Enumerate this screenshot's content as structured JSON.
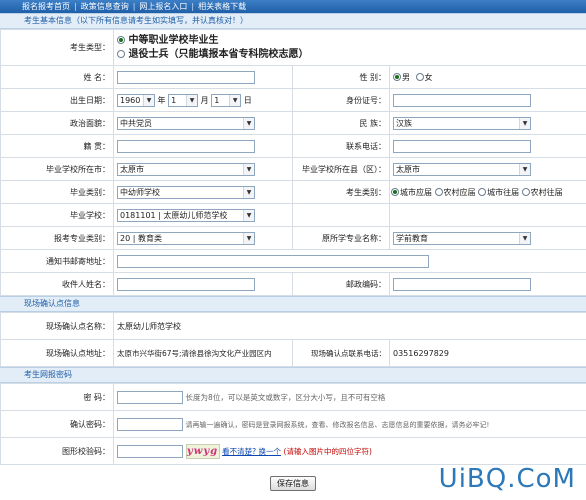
{
  "nav": {
    "items": [
      "报名报考首页",
      "政策信息查询",
      "网上报名入口",
      "相关表格下载"
    ],
    "separator": "|"
  },
  "basic_section": {
    "title": "考生基本信息（以下所有信息请考生如实填写，并认真核对！）"
  },
  "candidate_type": {
    "label": "考生类型：",
    "options": [
      "中等职业学校毕业生",
      "退役士兵（只能填报本省专科院校志愿）"
    ],
    "selected": 0
  },
  "fields": {
    "name_label": "姓 名：",
    "gender_label": "性 别：",
    "gender_male": "男",
    "gender_female": "女",
    "birth_label": "出生日期：",
    "birth_year": "1960",
    "birth_year_unit": "年",
    "birth_month": "1",
    "birth_month_unit": "月",
    "birth_day": "1",
    "birth_day_unit": "日",
    "id_label": "身份证号：",
    "politics_label": "政治面貌：",
    "politics_value": "中共党员",
    "ethnic_label": "民 族：",
    "ethnic_value": "汉族",
    "native_label": "籍 贯：",
    "phone_label": "联系电话：",
    "city_label": "毕业学校所在市：",
    "city_value": "太原市",
    "county_label": "毕业学校所在县（区）：",
    "county_value": "太原市",
    "grad_type_label": "毕业类别：",
    "grad_type_value": "中幼师学校",
    "cand_cat_label": "考生类别：",
    "cand_cat_options": [
      "城市应届",
      "农村应届",
      "城市往届",
      "农村往届"
    ],
    "school_label": "毕业学校：",
    "school_value": "0181101 | 太原幼儿师范学校",
    "major_cat_label": "报考专业类别：",
    "major_cat_value": "20 | 教育类",
    "orig_major_label": "原所学专业名称：",
    "orig_major_value": "学前教育",
    "mail_label": "通知书邮寄地址：",
    "recipient_label": "收件人姓名：",
    "postcode_label": "邮政编码："
  },
  "confirm_section": {
    "title": "现场确认点信息",
    "point_name_label": "现场确认点名称：",
    "point_name_value": "太原幼儿师范学校",
    "point_addr_label": "现场确认点地址：",
    "point_addr_value": "太原市兴华街67号;清徐县徐沟文化产业园区内",
    "point_phone_label": "现场确认点联系电话：",
    "point_phone_value": "03516297829"
  },
  "password_section": {
    "title": "考生网报密码",
    "pw_label": "密 码：",
    "pw_hint": "长度为8位，可以是英文或数字，区分大小写，且不可有空格",
    "confirm_label": "确认密码：",
    "confirm_hint": "请再输一遍确认，密码是登录网报系统，查看、修改报名信息、志愿信息的重要依据，请务必牢记!",
    "captcha_label": "图形校验码：",
    "captcha_text": "ywyg",
    "captcha_link1": "看不清楚? ",
    "captcha_link2": "换一个",
    "captcha_hint": "(请输入图片中的四位字符)"
  },
  "submit_label": "保存信息",
  "watermark": "UiBQ.CoM"
}
